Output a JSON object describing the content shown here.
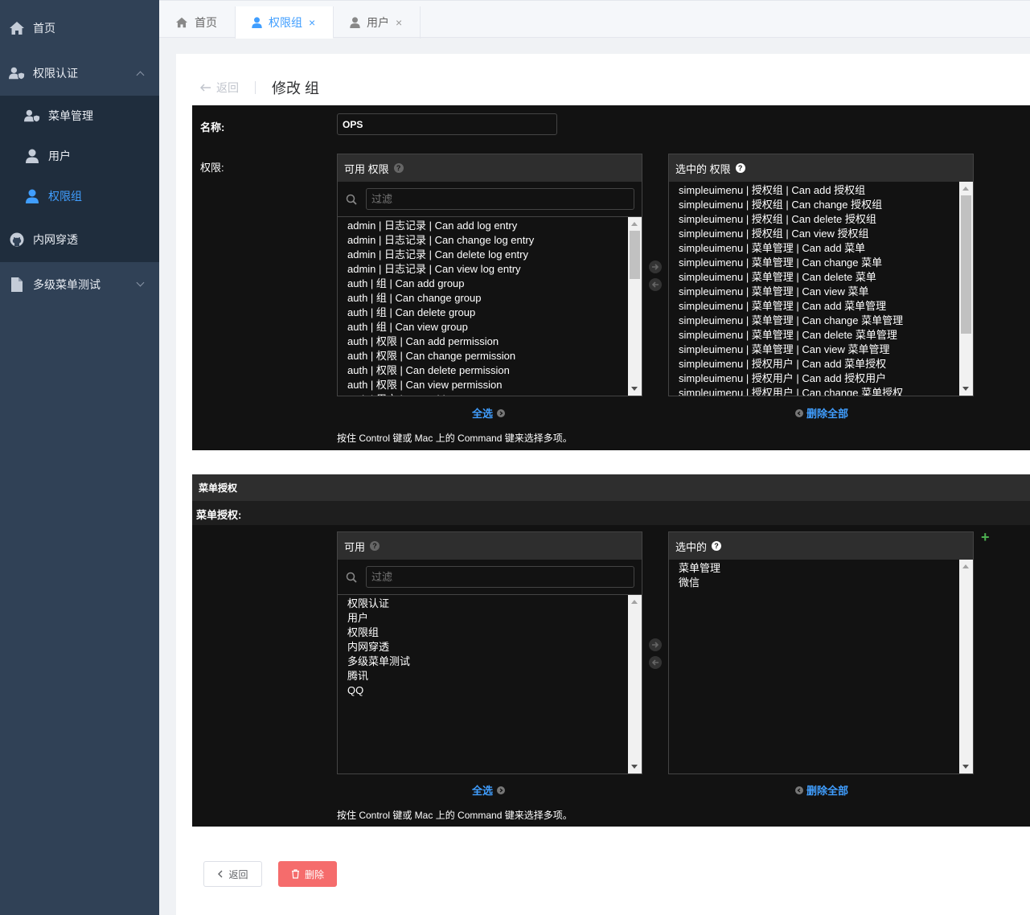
{
  "sidebar": {
    "items": [
      {
        "label": "首页",
        "icon": "home-icon"
      },
      {
        "label": "权限认证",
        "icon": "user-shield-icon"
      },
      {
        "label": "菜单管理",
        "icon": "user-shield-icon"
      },
      {
        "label": "用户",
        "icon": "user-icon"
      },
      {
        "label": "权限组",
        "icon": "user-icon"
      },
      {
        "label": "内网穿透",
        "icon": "github-icon"
      },
      {
        "label": "多级菜单测试",
        "icon": "file-icon"
      }
    ]
  },
  "tabs": [
    {
      "label": "首页",
      "icon": "home-icon"
    },
    {
      "label": "权限组",
      "icon": "user-icon",
      "close": "×"
    },
    {
      "label": "用户",
      "icon": "user-icon",
      "close": "×"
    }
  ],
  "header": {
    "back_label": "返回",
    "title": "修改 组"
  },
  "form": {
    "name_label": "名称:",
    "name_value": "OPS",
    "permissions_label": "权限:",
    "available_title": "可用 权限",
    "chosen_title": "选中的 权限",
    "filter_placeholder": "过滤",
    "available_options": [
      "admin | 日志记录 | Can add log entry",
      "admin | 日志记录 | Can change log entry",
      "admin | 日志记录 | Can delete log entry",
      "admin | 日志记录 | Can view log entry",
      "auth | 组 | Can add group",
      "auth | 组 | Can change group",
      "auth | 组 | Can delete group",
      "auth | 组 | Can view group",
      "auth | 权限 | Can add permission",
      "auth | 权限 | Can change permission",
      "auth | 权限 | Can delete permission",
      "auth | 权限 | Can view permission",
      "auth | 用户 | Can add user"
    ],
    "chosen_options": [
      "simpleuimenu | 授权组 | Can add 授权组",
      "simpleuimenu | 授权组 | Can change 授权组",
      "simpleuimenu | 授权组 | Can delete 授权组",
      "simpleuimenu | 授权组 | Can view 授权组",
      "simpleuimenu | 菜单管理 | Can add 菜单",
      "simpleuimenu | 菜单管理 | Can change 菜单",
      "simpleuimenu | 菜单管理 | Can delete 菜单",
      "simpleuimenu | 菜单管理 | Can view 菜单",
      "simpleuimenu | 菜单管理 | Can add 菜单管理",
      "simpleuimenu | 菜单管理 | Can change 菜单管理",
      "simpleuimenu | 菜单管理 | Can delete 菜单管理",
      "simpleuimenu | 菜单管理 | Can view 菜单管理",
      "simpleuimenu | 授权用户 | Can add 菜单授权",
      "simpleuimenu | 授权用户 | Can add 授权用户",
      "simpleuimenu | 授权用户 | Can change 菜单授权"
    ],
    "choose_all": "全选",
    "remove_all": "删除全部",
    "help_text": "按住 Control 键或 Mac 上的 Command 键来选择多项。"
  },
  "inline": {
    "section_title": "菜单授权",
    "field_label": "菜单授权:",
    "available_title": "可用",
    "chosen_title": "选中的",
    "filter_placeholder": "过滤",
    "available_options": [
      "权限认证",
      "用户",
      "权限组",
      "内网穿透",
      "多级菜单测试",
      "腾讯",
      "QQ"
    ],
    "chosen_options": [
      "菜单管理",
      "微信"
    ],
    "choose_all": "全选",
    "remove_all": "删除全部",
    "help_text": "按住 Control 键或 Mac 上的 Command 键来选择多项。",
    "add_symbol": "+"
  },
  "actions": {
    "back_label": "返回",
    "delete_label": "删除"
  },
  "colors": {
    "sidebar_bg": "#304156",
    "submenu_bg": "#1f2d3d",
    "accent": "#409eff",
    "danger": "#f56c6c",
    "panel_bg": "#121212"
  }
}
